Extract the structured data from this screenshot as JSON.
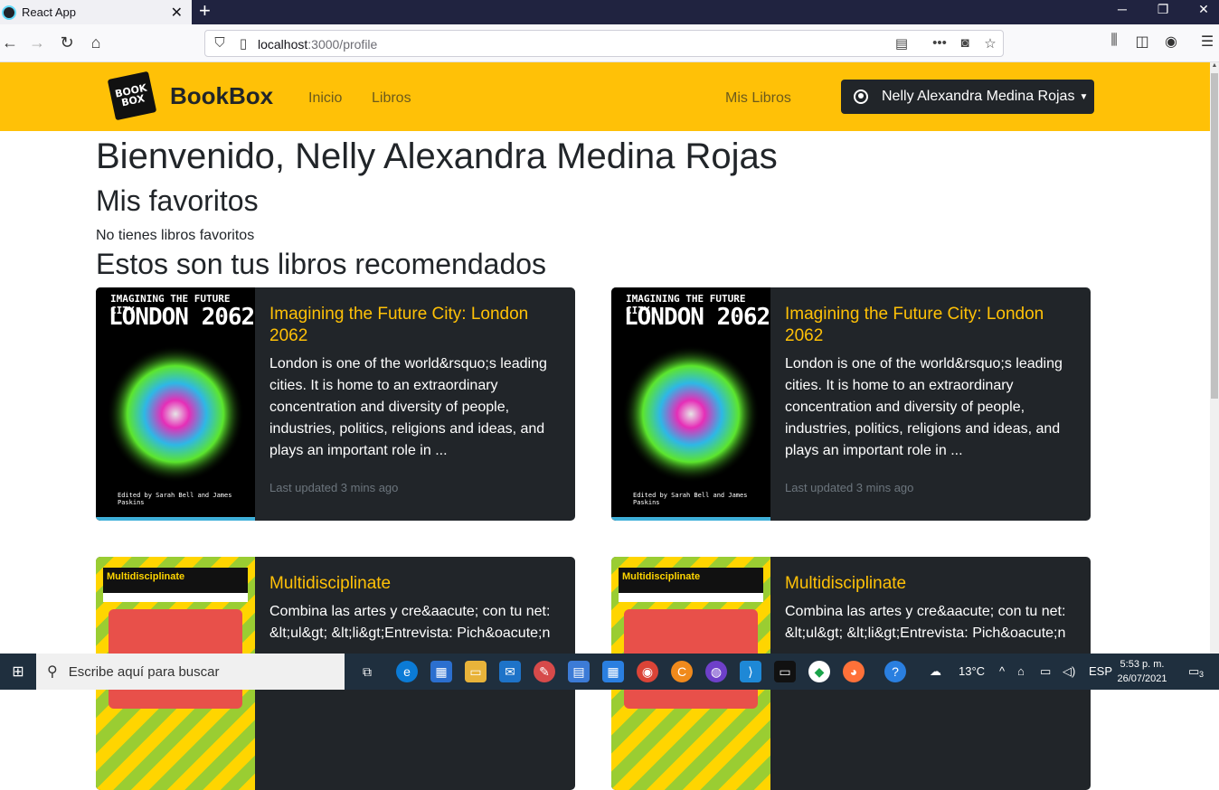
{
  "browser": {
    "tab_title": "React App",
    "tab_close": "✕",
    "new_tab": "+",
    "url_host": "localhost",
    "url_rest": ":3000/profile"
  },
  "site": {
    "logo_line1": "BOOK",
    "logo_line2": "BOX",
    "brand": "BookBox",
    "nav": [
      "Inicio",
      "Libros"
    ],
    "nav_right": "Mis Libros",
    "user_name": "Nelly Alexandra Medina Rojas"
  },
  "page": {
    "welcome": "Bienvenido, Nelly Alexandra Medina Rojas",
    "favorites_heading": "Mis favoritos",
    "no_favorites": "No tienes libros favoritos",
    "recommended_heading": "Estos son tus libros recomendados"
  },
  "books": [
    {
      "cover_line1": "IMAGINING THE FUTURE CITY:",
      "cover_line2": "LONDON 2062",
      "cover_editors": "Edited by Sarah Bell and James Paskins",
      "title": "Imagining the Future City: London 2062",
      "text": "London is one of the world&rsquo;s leading cities. It is home to an extraordinary concentration and diversity of people, industries, politics, religions and ideas, and plays an important role in ...",
      "updated": "Last updated 3 mins ago"
    },
    {
      "cover_line1": "IMAGINING THE FUTURE CITY:",
      "cover_line2": "LONDON 2062",
      "cover_editors": "Edited by Sarah Bell and James Paskins",
      "title": "Imagining the Future City: London 2062",
      "text": "London is one of the world&rsquo;s leading cities. It is home to an extraordinary concentration and diversity of people, industries, politics, religions and ideas, and plays an important role in ...",
      "updated": "Last updated 3 mins ago"
    },
    {
      "cover_line1": "Multidisciplinate",
      "title": "Multidisciplinate",
      "text": "Combina las artes y cre&aacute; con tu net: &lt;ul&gt; &lt;li&gt;Entrevista: Pich&oacute;n"
    },
    {
      "cover_line1": "Multidisciplinate",
      "title": "Multidisciplinate",
      "text": "Combina las artes y cre&aacute; con tu net: &lt;ul&gt; &lt;li&gt;Entrevista: Pich&oacute;n"
    }
  ],
  "taskbar": {
    "search_placeholder": "Escribe aquí para buscar",
    "weather": "13°C",
    "lang": "ESP",
    "time": "5:53 p. m.",
    "date": "26/07/2021",
    "notifications": "3"
  }
}
